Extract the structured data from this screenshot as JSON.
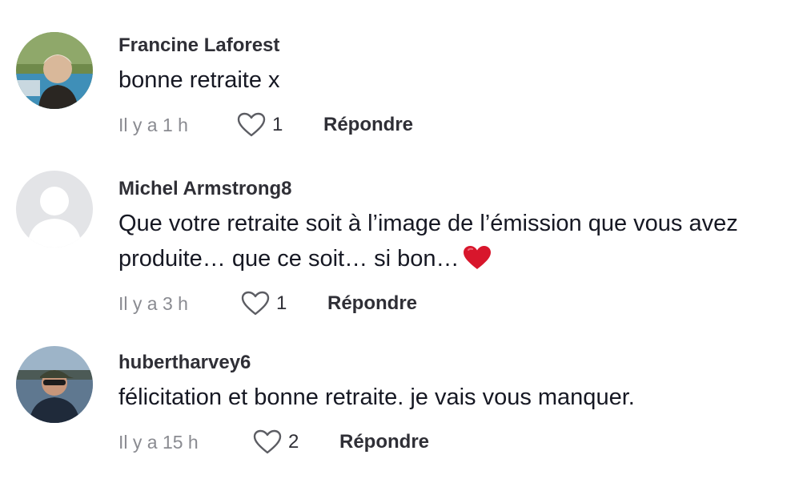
{
  "comments": [
    {
      "username": "Francine Laforest",
      "text": "bonne retraite x",
      "time": "Il y a 1 h",
      "likes": "1",
      "reply_label": "Répondre",
      "avatar_icon": "avatar-photo-woman"
    },
    {
      "username": "Michel Armstrong8",
      "text": "Que votre retraite soit à l’image de l’émission que vous avez produite… que ce soit… si bon…",
      "emoji": "red-heart-emoji",
      "time": "Il y a 3 h",
      "likes": "1",
      "reply_label": "Répondre",
      "avatar_icon": "default-avatar-silhouette"
    },
    {
      "username": "hubertharvey6",
      "text": "félicitation et bonne retraite. je vais vous manquer.",
      "time": "Il y a 15 h",
      "likes": "2",
      "reply_label": "Répondre",
      "avatar_icon": "avatar-photo-man-cap"
    }
  ],
  "colors": {
    "text": "#161823",
    "muted": "#8a8b91",
    "heart": "#d8162c"
  }
}
